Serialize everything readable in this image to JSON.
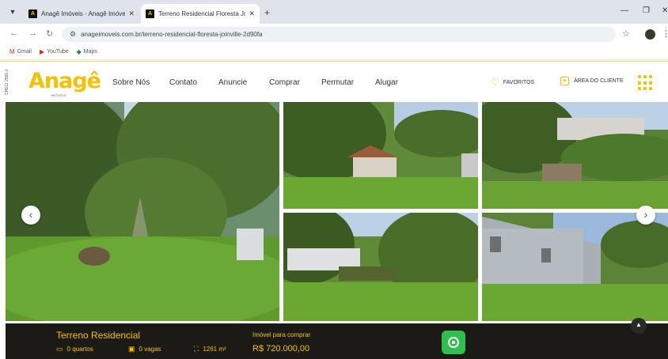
{
  "browser": {
    "tabs": [
      {
        "title": "Anagê Imóveis - Anagê Imóveis",
        "active": false
      },
      {
        "title": "Terreno Residencial Floresta Jo",
        "active": true
      }
    ],
    "new_tab_icon": "+",
    "url": "anageimoveis.com.br/terreno-residencial-floresta-joinville-2d90fa",
    "bookmarks": [
      {
        "label": "Gmail",
        "icon": "gmail-icon"
      },
      {
        "label": "YouTube",
        "icon": "youtube-icon"
      },
      {
        "label": "Maps",
        "icon": "maps-icon"
      }
    ]
  },
  "site": {
    "creci": "CRECI 2581-J",
    "logo_text": "Anagê",
    "logo_sub": "IMÓVEIS",
    "menu": [
      "Sobre Nós",
      "Contato",
      "Anuncie",
      "Comprar",
      "Permutar",
      "Alugar"
    ],
    "favorites_label": "FAVORITOS",
    "client_area_label": "ÁREA DO CLIENTE"
  },
  "property": {
    "title": "Terreno Residencial",
    "rooms": "0 quartos",
    "parking": "0 vagas",
    "area": "1261 m²",
    "buy_label": "Imóvel para comprar",
    "price": "R$ 720.000,00"
  },
  "colors": {
    "brand_yellow": "#f6c100",
    "dark_bar": "#1b1a17",
    "whatsapp_green": "#2fbf4c"
  }
}
